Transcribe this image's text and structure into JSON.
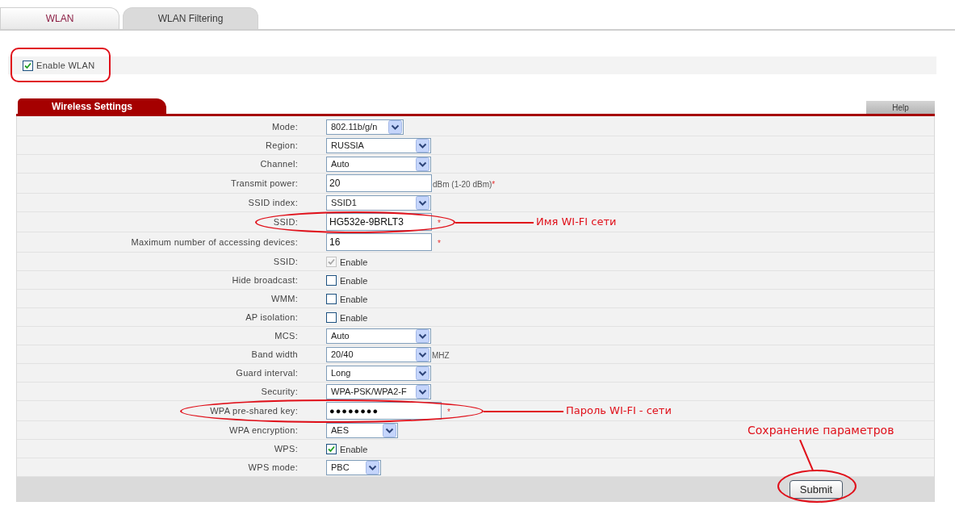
{
  "tabs": [
    {
      "label": "WLAN",
      "selected": true
    },
    {
      "label": "WLAN Filtering",
      "selected": false
    }
  ],
  "enable_wlan": {
    "label": "Enable WLAN",
    "checked": true,
    "highlighted": true
  },
  "section": {
    "title": "Wireless Settings",
    "help": "Help"
  },
  "rows": [
    {
      "kind": "select",
      "label": "Mode:",
      "value": "802.11b/g/n"
    },
    {
      "kind": "select",
      "label": "Region:",
      "value": "RUSSIA"
    },
    {
      "kind": "select",
      "label": "Channel:",
      "value": "Auto"
    },
    {
      "kind": "text",
      "label": "Transmit power:",
      "value": "20",
      "suffix": "dBm (1-20 dBm)",
      "required_mark": "*"
    },
    {
      "kind": "select",
      "label": "SSID index:",
      "value": "SSID1"
    },
    {
      "kind": "text",
      "label": "SSID:",
      "value": "HG532e-9BRLT3",
      "required_mark": "*",
      "note": "Имя WI-FI сети"
    },
    {
      "kind": "text",
      "label": "Maximum number of accessing devices:",
      "value": "16",
      "required_mark": "*"
    },
    {
      "kind": "checkbox",
      "label": "SSID:",
      "option": "Enable",
      "checked": true,
      "disabled": true
    },
    {
      "kind": "checkbox",
      "label": "Hide broadcast:",
      "option": "Enable",
      "checked": false,
      "disabled": false
    },
    {
      "kind": "checkbox",
      "label": "WMM:",
      "option": "Enable",
      "checked": false,
      "disabled": false
    },
    {
      "kind": "checkbox",
      "label": "AP isolation:",
      "option": "Enable",
      "checked": false,
      "disabled": false
    },
    {
      "kind": "select",
      "label": "MCS:",
      "value": "Auto"
    },
    {
      "kind": "select",
      "label": "Band width",
      "value": "20/40",
      "suffix": "MHZ"
    },
    {
      "kind": "select",
      "label": "Guard interval:",
      "value": "Long"
    },
    {
      "kind": "select",
      "label": "Security:",
      "value": "WPA-PSK/WPA2-F"
    },
    {
      "kind": "password",
      "label": "WPA pre-shared key:",
      "value": "●●●●●●●●",
      "required_mark": "*",
      "note": "Пароль WI-FI - сети"
    },
    {
      "kind": "select",
      "label": "WPA encryption:",
      "value": "AES"
    },
    {
      "kind": "checkbox",
      "label": "WPS:",
      "option": "Enable",
      "checked": true,
      "disabled": false
    },
    {
      "kind": "select",
      "label": "WPS mode:",
      "value": "PBC"
    }
  ],
  "submit": {
    "label": "Submit",
    "note": "Сохранение параметров"
  }
}
